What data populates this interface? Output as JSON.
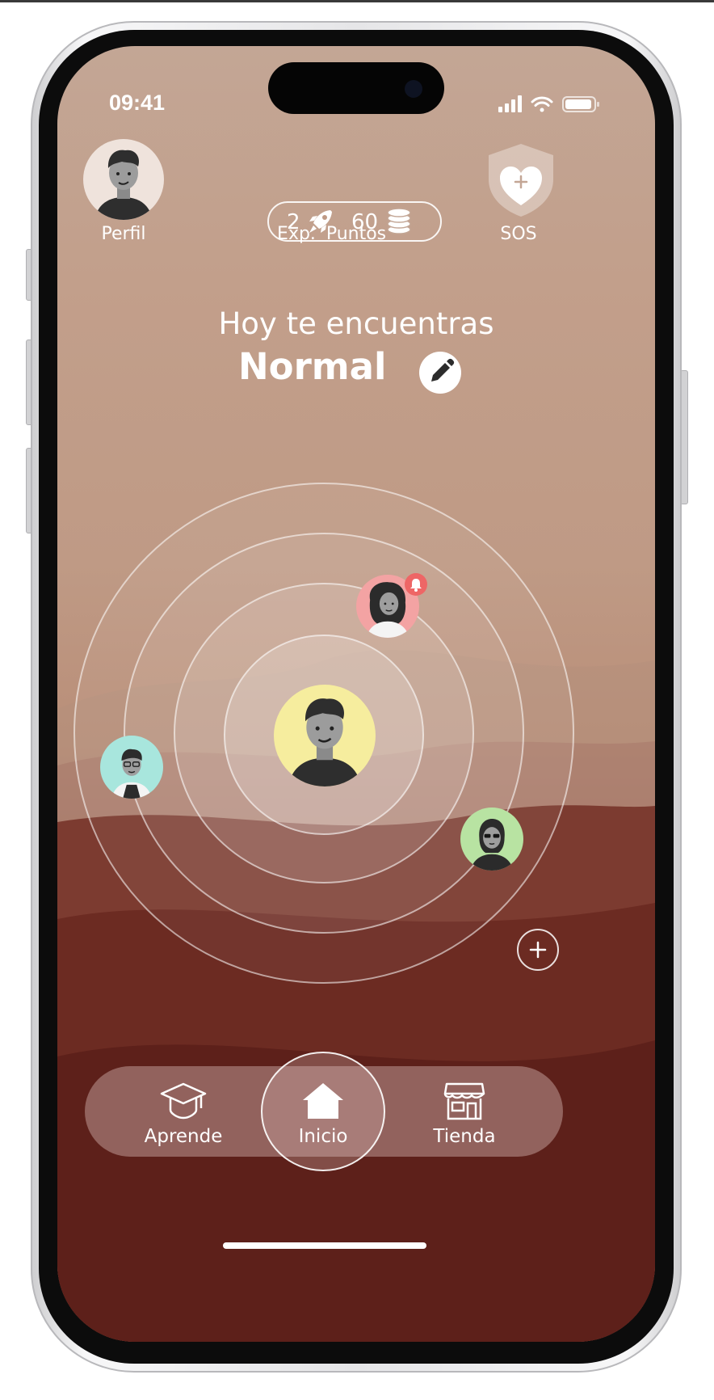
{
  "status": {
    "time": "09:41"
  },
  "header": {
    "profile_label": "Perfil",
    "exp_value": "2",
    "exp_label": "Exp.",
    "points_value": "60",
    "points_label": "Puntos",
    "sos_label": "SOS"
  },
  "mood": {
    "intro": "Hoy te encuentras",
    "value": "Normal"
  },
  "friends": [
    {
      "name": "friend-woman",
      "bg": "#f3a3a3",
      "has_notification": true
    },
    {
      "name": "friend-man-glasses",
      "bg": "#a8e6dd",
      "has_notification": false
    },
    {
      "name": "friend-woman-sunglasses",
      "bg": "#b8e3a2",
      "has_notification": false
    }
  ],
  "user_avatar_bg": "#f6ed9e",
  "nav": {
    "learn_label": "Aprende",
    "home_label": "Inicio",
    "store_label": "Tienda"
  },
  "icons": [
    "rocket-icon",
    "coins-icon",
    "shield-heart-icon",
    "pencil-icon",
    "plus-icon",
    "graduation-cap-icon",
    "home-icon",
    "store-icon",
    "bell-icon"
  ]
}
